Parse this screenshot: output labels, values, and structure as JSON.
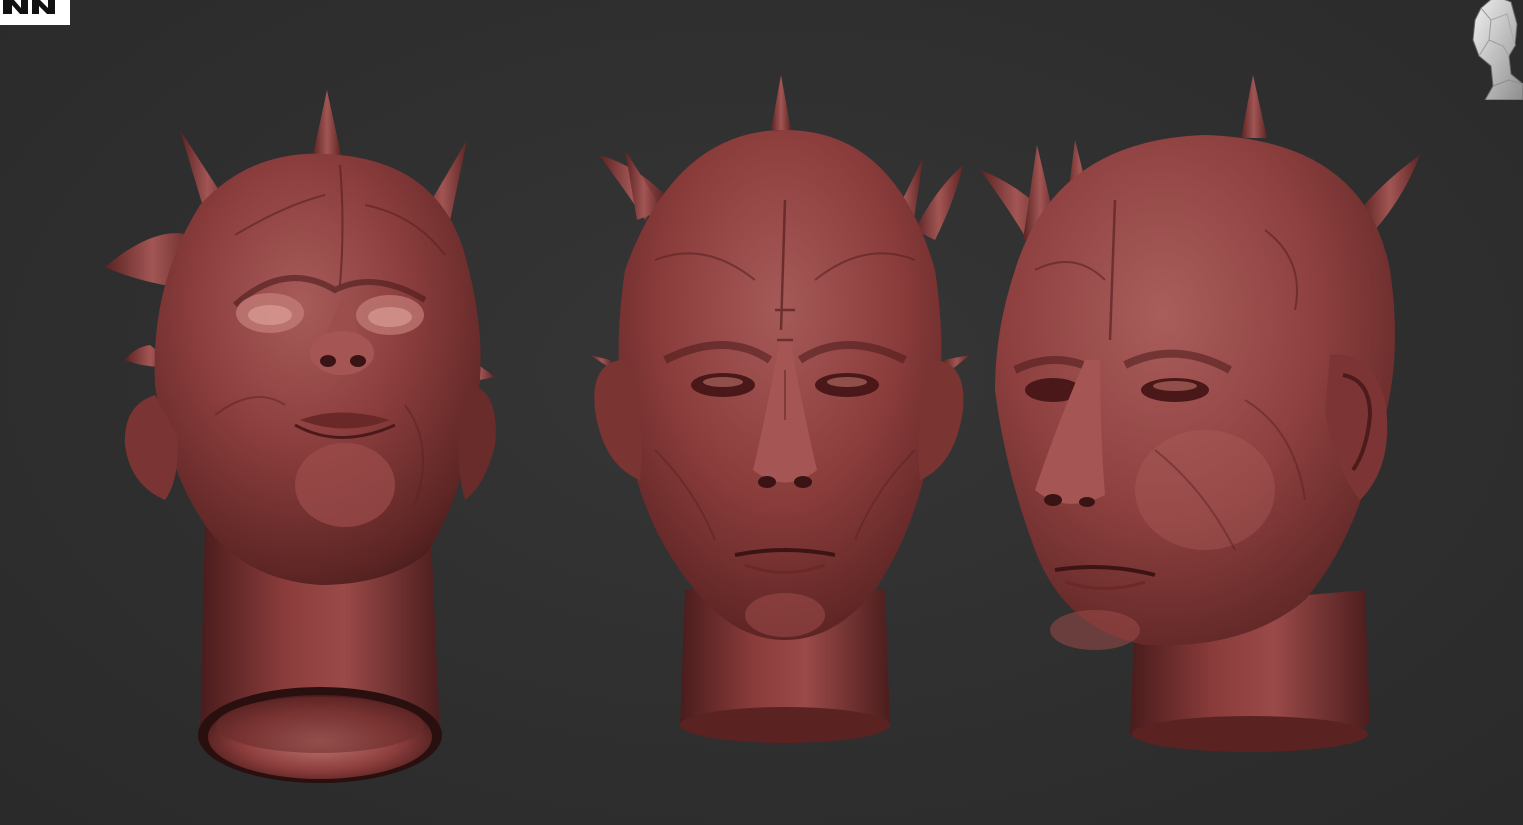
{
  "viewport": {
    "background_color": "#2f2f2f",
    "model_color": "#8a3a3a"
  },
  "corner_logo": {
    "icon": "partial-app-logo-icon"
  },
  "navigation": {
    "icon": "head-orientation-navigator-icon"
  },
  "models": [
    {
      "name": "head-model-low-angle",
      "icon": "sculpted-head-3-4-low-view"
    },
    {
      "name": "head-model-front",
      "icon": "sculpted-head-front-view"
    },
    {
      "name": "head-model-three-quarter",
      "icon": "sculpted-head-3-4-side-view"
    }
  ]
}
